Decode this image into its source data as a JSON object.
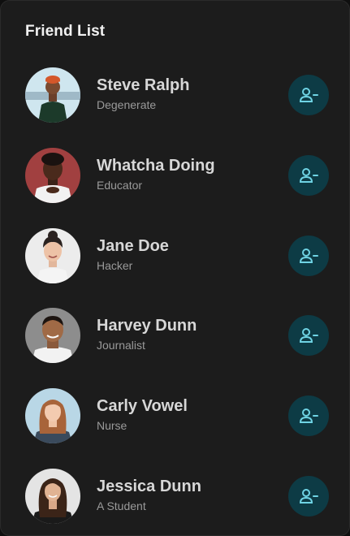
{
  "header": {
    "title": "Friend List"
  },
  "colors": {
    "card_background": "#1c1c1c",
    "button_background": "#0d3b45",
    "icon_color": "#6fd3e4"
  },
  "friends": [
    {
      "name": "Steve Ralph",
      "role": "Degenerate",
      "action_icon": "remove-user-icon"
    },
    {
      "name": "Whatcha Doing",
      "role": "Educator",
      "action_icon": "remove-user-icon"
    },
    {
      "name": "Jane Doe",
      "role": "Hacker",
      "action_icon": "remove-user-icon"
    },
    {
      "name": "Harvey Dunn",
      "role": "Journalist",
      "action_icon": "remove-user-icon"
    },
    {
      "name": "Carly Vowel",
      "role": "Nurse",
      "action_icon": "remove-user-icon"
    },
    {
      "name": "Jessica Dunn",
      "role": "A Student",
      "action_icon": "remove-user-icon"
    }
  ]
}
